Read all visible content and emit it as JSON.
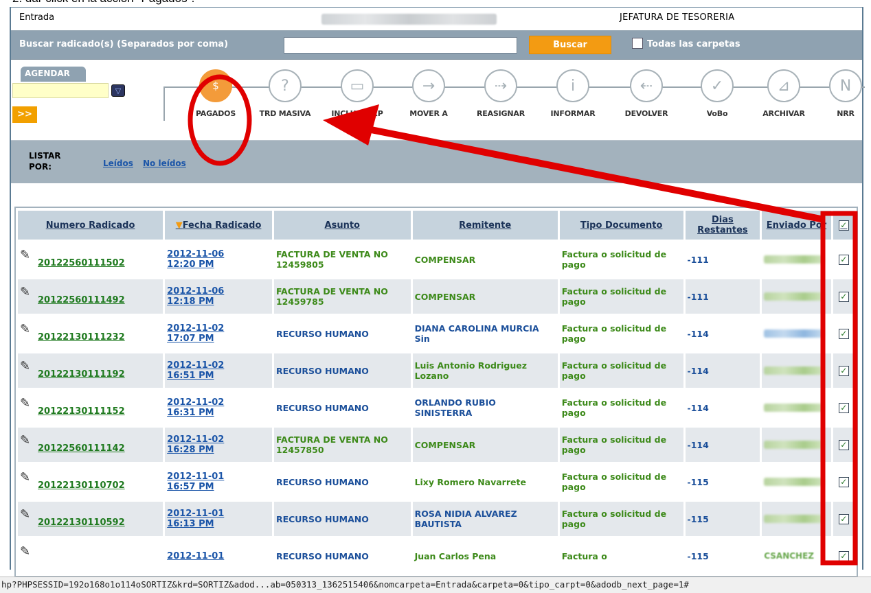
{
  "caption": "2.   dar click en la acción \"Pagados\".",
  "header": {
    "section": "Entrada",
    "department": "JEFATURA DE TESORERIA"
  },
  "search": {
    "label": "Buscar radicado(s) (Separados por coma)",
    "value": "",
    "button": "Buscar",
    "all_folders": "Todas las carpetas"
  },
  "agendar": {
    "tab": "AGENDAR",
    "go": ">>"
  },
  "actions": [
    {
      "label": "PAGADOS",
      "icon": "dollar-icon",
      "glyph": "$"
    },
    {
      "label": "TRD MASIVA",
      "icon": "document-question-icon",
      "glyph": "?"
    },
    {
      "label": "INCLUIR EXP",
      "icon": "folder-icon",
      "glyph": "▭"
    },
    {
      "label": "MOVER A",
      "icon": "arrow-right-icon",
      "glyph": "→"
    },
    {
      "label": "REASIGNAR",
      "icon": "reassign-icon",
      "glyph": "⇢"
    },
    {
      "label": "INFORMAR",
      "icon": "info-icon",
      "glyph": "i"
    },
    {
      "label": "DEVOLVER",
      "icon": "return-icon",
      "glyph": "⇠"
    },
    {
      "label": "VoBo",
      "icon": "check-icon",
      "glyph": "✓"
    },
    {
      "label": "ARCHIVAR",
      "icon": "archive-icon",
      "glyph": "⊿"
    },
    {
      "label": "NRR",
      "icon": "n-icon",
      "glyph": "N"
    }
  ],
  "listar": {
    "label_1": "LISTAR",
    "label_2": "POR:",
    "read": "Leídos",
    "unread": "No leídos"
  },
  "table": {
    "headers": [
      "Numero Radicado",
      "Fecha Radicado",
      "Asunto",
      "Remitente",
      "Tipo Documento",
      "Dias Restantes",
      "Enviado Por"
    ],
    "sort_marker": "▼",
    "rows": [
      {
        "numero": "20122560111502",
        "fecha": "2012-11-06",
        "hora": "12:20 PM",
        "asunto": "FACTURA DE VENTA NO 12459805",
        "remitente": "COMPENSAR",
        "tipo": "Factura o solicitud de pago",
        "dias": "-111",
        "checked": true
      },
      {
        "numero": "20122560111492",
        "fecha": "2012-11-06",
        "hora": "12:18 PM",
        "asunto": "FACTURA DE VENTA NO 12459785",
        "remitente": "COMPENSAR",
        "tipo": "Factura o solicitud de pago",
        "dias": "-111",
        "checked": true
      },
      {
        "numero": "20122130111232",
        "fecha": "2012-11-02",
        "hora": "17:07 PM",
        "asunto": "RECURSO HUMANO",
        "remitente": "DIANA CAROLINA MURCIA Sin",
        "tipo": "Factura o solicitud de pago",
        "dias": "-114",
        "checked": true
      },
      {
        "numero": "20122130111192",
        "fecha": "2012-11-02",
        "hora": "16:51 PM",
        "asunto": "RECURSO HUMANO",
        "remitente": "Luis Antonio Rodriguez Lozano",
        "tipo": "Factura o solicitud de pago",
        "dias": "-114",
        "checked": true
      },
      {
        "numero": "20122130111152",
        "fecha": "2012-11-02",
        "hora": "16:31 PM",
        "asunto": "RECURSO HUMANO",
        "remitente": "ORLANDO RUBIO SINISTERRA",
        "tipo": "Factura o solicitud de pago",
        "dias": "-114",
        "checked": true
      },
      {
        "numero": "20122560111142",
        "fecha": "2012-11-02",
        "hora": "16:28 PM",
        "asunto": "FACTURA DE VENTA NO 12457850",
        "remitente": "COMPENSAR",
        "tipo": "Factura o solicitud de pago",
        "dias": "-114",
        "checked": true
      },
      {
        "numero": "20122130110702",
        "fecha": "2012-11-01",
        "hora": "16:57 PM",
        "asunto": "RECURSO HUMANO",
        "remitente": "Lixy Romero Navarrete",
        "tipo": "Factura o solicitud de pago",
        "dias": "-115",
        "checked": true
      },
      {
        "numero": "20122130110592",
        "fecha": "2012-11-01",
        "hora": "16:13 PM",
        "asunto": "RECURSO HUMANO",
        "remitente": "ROSA NIDIA ALVAREZ BAUTISTA",
        "tipo": "Factura o solicitud de pago",
        "dias": "-115",
        "checked": true
      },
      {
        "numero": "",
        "fecha": "2012-11-01",
        "hora": "",
        "asunto": "RECURSO HUMANO",
        "remitente": "Juan Carlos Pena",
        "tipo": "Factura o",
        "dias": "-115",
        "enviado": "CSANCHEZ",
        "checked": true
      }
    ]
  },
  "status_url": "hp?PHPSESSID=192o168o1o114oSORTIZ&krd=SORTIZ&adod...ab=050313_1362515406&nomcarpeta=Entrada&carpeta=0&tipo_carpt=0&adodb_next_page=1#",
  "colors": {
    "accent_orange": "#f39b12",
    "header_bar": "#8fa2b1",
    "annotation_red": "#e00000"
  }
}
